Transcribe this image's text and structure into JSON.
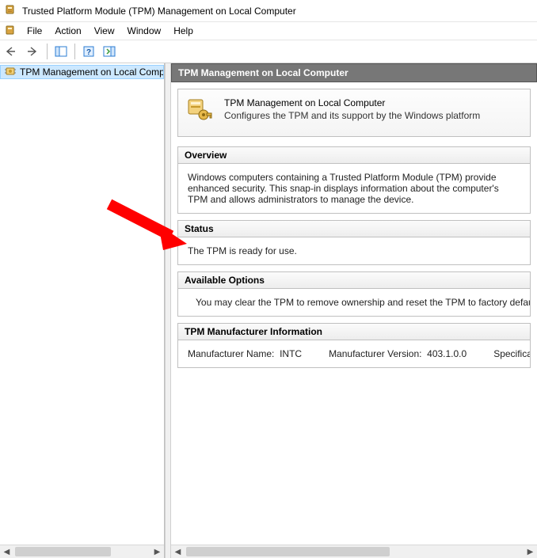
{
  "window": {
    "title": "Trusted Platform Module (TPM) Management on Local Computer"
  },
  "menu": {
    "file": "File",
    "action": "Action",
    "view": "View",
    "window": "Window",
    "help": "Help"
  },
  "tree": {
    "selected_label": "TPM Management on Local Comp"
  },
  "pane": {
    "header": "TPM Management on Local Computer",
    "intro_title": "TPM Management on Local Computer",
    "intro_sub": "Configures the TPM and its support by the Windows platform"
  },
  "sections": {
    "overview": {
      "title": "Overview",
      "body": "Windows computers containing a Trusted Platform Module (TPM) provide enhanced security. This snap-in displays information about the computer's TPM and allows administrators to manage the device."
    },
    "status": {
      "title": "Status",
      "body": "The TPM is ready for use."
    },
    "options": {
      "title": "Available Options",
      "body": "You may clear the TPM to remove ownership and reset the TPM to factory defaults."
    },
    "mfr": {
      "title": "TPM Manufacturer Information",
      "name_label": "Manufacturer Name:",
      "name_value": "INTC",
      "version_label": "Manufacturer Version:",
      "version_value": "403.1.0.0",
      "spec_label": "Specification Ver"
    }
  }
}
